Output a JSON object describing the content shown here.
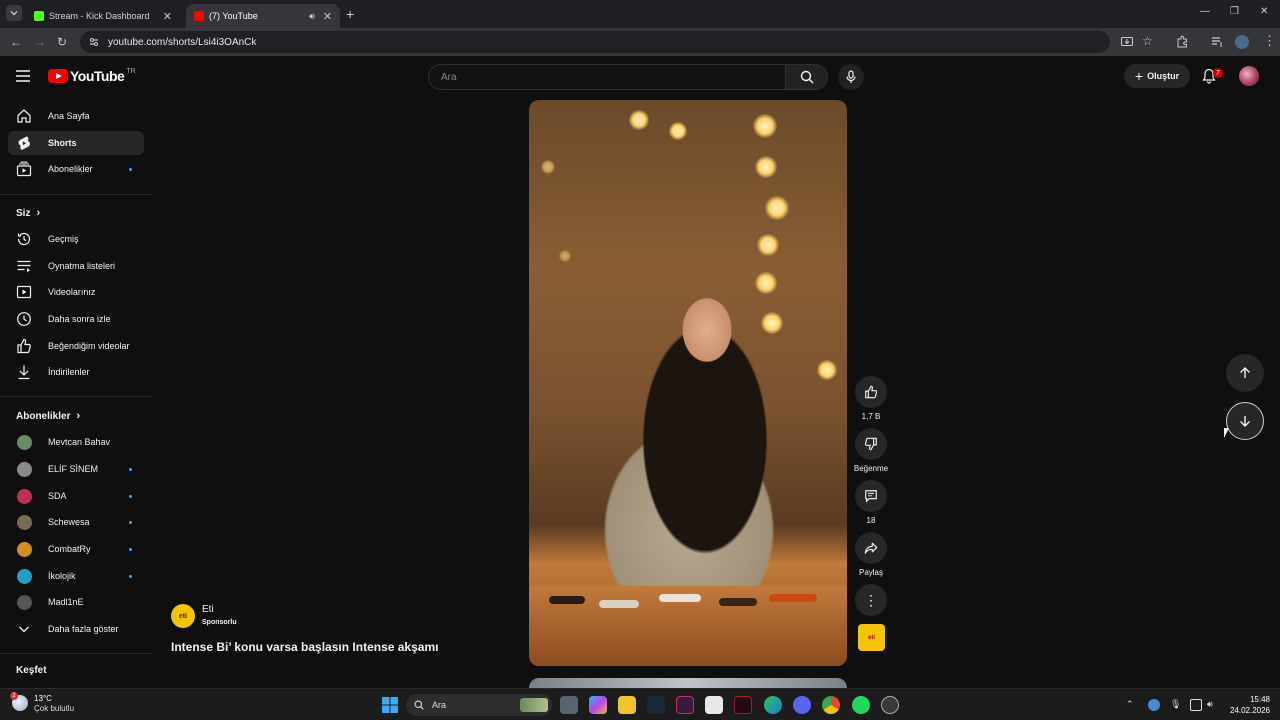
{
  "browser": {
    "tabs": [
      {
        "title": "Stream - Kick Dashboard",
        "favicon": "kick-icon",
        "color": "#53fc18"
      },
      {
        "title": "(7) YouTube",
        "favicon": "youtube-icon",
        "color": "#ff0000"
      }
    ],
    "url": "youtube.com/shorts/Lsi4i3OAnCk"
  },
  "masthead": {
    "logo_text": "YouTube",
    "country": "TR",
    "search_placeholder": "Ara",
    "create_label": "Oluştur",
    "notification_count": "7"
  },
  "sidebar": {
    "main": [
      {
        "label": "Ana Sayfa",
        "icon": "home-icon"
      },
      {
        "label": "Shorts",
        "icon": "shorts-icon",
        "active": true
      },
      {
        "label": "Abonelikler",
        "icon": "subscriptions-icon",
        "dot": true
      }
    ],
    "you_header": "Siz",
    "you": [
      {
        "label": "Geçmiş",
        "icon": "history-icon"
      },
      {
        "label": "Oynatma listeleri",
        "icon": "playlists-icon"
      },
      {
        "label": "Videolarınız",
        "icon": "your-videos-icon"
      },
      {
        "label": "Daha sonra izle",
        "icon": "watch-later-icon"
      },
      {
        "label": "Beğendiğim videolar",
        "icon": "liked-videos-icon"
      },
      {
        "label": "İndirilenler",
        "icon": "downloads-icon"
      }
    ],
    "subs_header": "Abonelikler",
    "subs": [
      {
        "label": "Mevtcan Bahav",
        "dot": false,
        "color": "#6a8a6a"
      },
      {
        "label": "ELİF SİNEM",
        "dot": true,
        "color": "#8a8a8a"
      },
      {
        "label": "SDA",
        "dot": true,
        "color": "#c03050"
      },
      {
        "label": "Schewesa",
        "dot": true,
        "color": "#7a6a5a"
      },
      {
        "label": "CombatRy",
        "dot": true,
        "color": "#d09020"
      },
      {
        "label": "İkolojik",
        "dot": true,
        "color": "#20a0c0"
      },
      {
        "label": "Madl1nE",
        "dot": false,
        "color": "#555555"
      }
    ],
    "show_more": "Daha fazla göster",
    "explore_header": "Keşfet"
  },
  "short": {
    "channel": "Eti",
    "sponsored": "Sponsorlu",
    "title": "Intense Bi’ konu varsa başlasın Intense akşamı",
    "brand_logo_text": "eti",
    "actions": {
      "likes": "1,7 B",
      "dislike": "Beğenme",
      "comments": "18",
      "share": "Paylaş"
    }
  },
  "taskbar": {
    "weather_temp": "13°C",
    "weather_desc": "Çok bulutlu",
    "weather_badge": "2",
    "search_label": "Ara",
    "time": "15:48",
    "date": "24.02.2026"
  },
  "colors": {
    "accent": "#ff0000",
    "background": "#0f0f0f",
    "unread_dot": "#3ea6ff"
  }
}
